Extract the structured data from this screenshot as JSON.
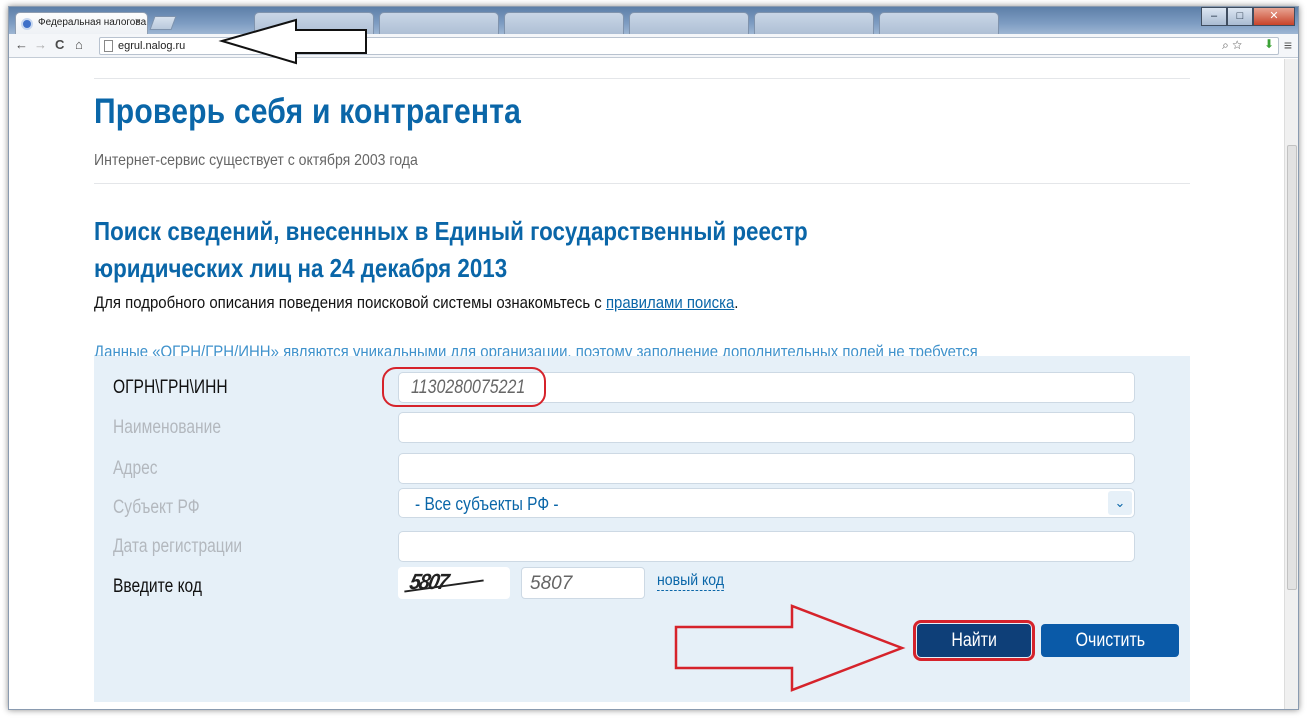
{
  "browser": {
    "tabs": [
      {
        "label": "Федеральная налогова",
        "active": true
      },
      {
        "label": "",
        "active": false
      },
      {
        "label": "",
        "active": false
      },
      {
        "label": "",
        "active": false
      },
      {
        "label": "",
        "active": false
      },
      {
        "label": "",
        "active": false
      },
      {
        "label": "",
        "active": false
      }
    ],
    "address": "egrul.nalog.ru",
    "icons": [
      "back-icon",
      "forward-icon",
      "reload-icon",
      "home-icon",
      "zoom-icon",
      "star-icon",
      "extension-icon",
      "menu-icon"
    ]
  },
  "page": {
    "title": "Проверь себя и контрагента",
    "subtitle": "Интернет-сервис существует с октября 2003 года",
    "section_title_line1": "Поиск сведений, внесенных в Единый государственный реестр",
    "section_title_line2": "юридических лиц на 24 декабря 2013",
    "description_prefix": "Для подробного описания поведения поисковой системы ознакомьтесь с ",
    "description_link": "правилами поиска",
    "description_suffix": ".",
    "note": "Данные «ОГРН/ГРН/ИНН» являются уникальными для организации, поэтому заполнение дополнительных полей не требуется"
  },
  "form": {
    "ogrn_label": "ОГРН\\ГРН\\ИНН",
    "ogrn_value": "1130280075221",
    "name_label": "Наименование",
    "name_value": "",
    "address_label": "Адрес",
    "address_value": "",
    "region_label": "Субъект РФ",
    "region_value": "- Все субъекты РФ -",
    "regdate_label": "Дата регистрации",
    "regdate_value": "",
    "code_label": "Введите код",
    "captcha_text": "5807",
    "code_value": "5807",
    "new_code_link": "новый код",
    "find_button": "Найти",
    "clear_button": "Очистить"
  },
  "colors": {
    "accent": "#0a66a8",
    "annotation_red": "#d6232b",
    "form_bg": "#e6f0f8"
  }
}
